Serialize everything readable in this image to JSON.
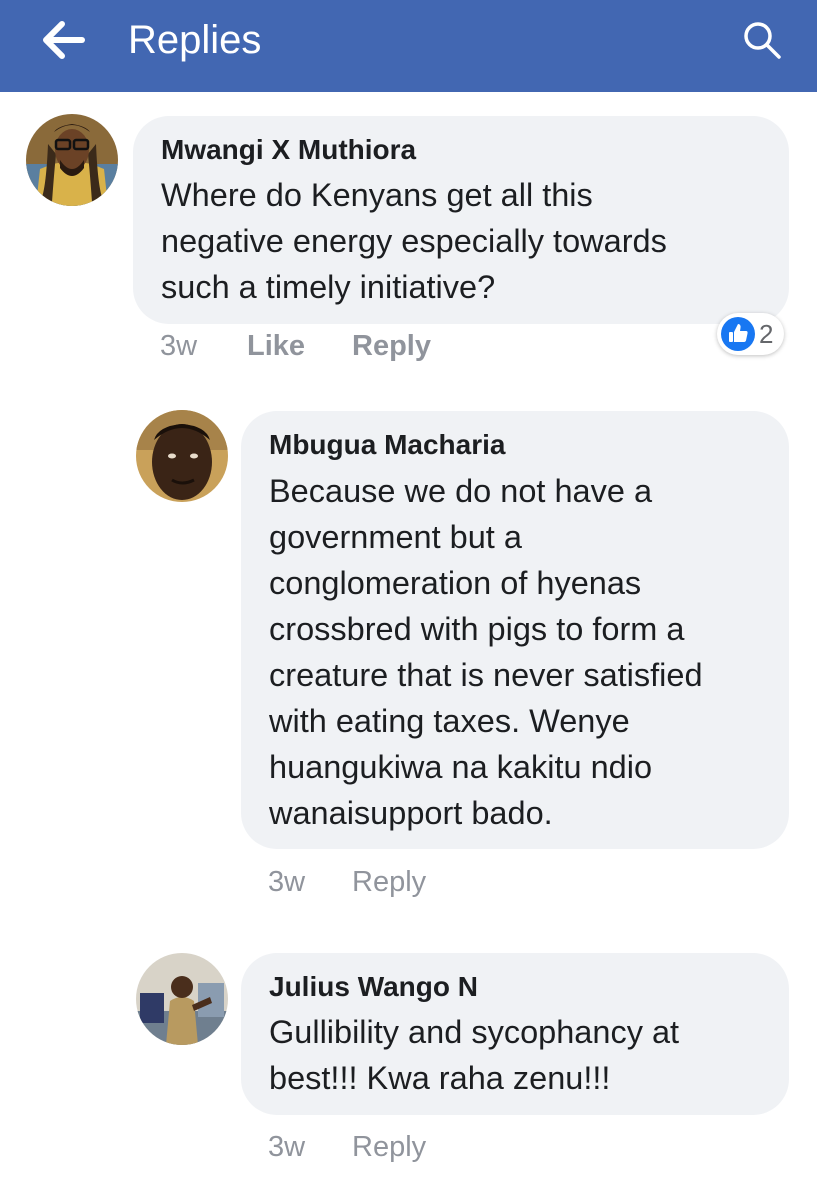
{
  "header": {
    "title": "Replies",
    "background": "#4267b2",
    "back_icon": "arrow-left-icon",
    "search_icon": "search-icon"
  },
  "comments": [
    {
      "author": "Mwangi X Muthiora",
      "text": "Where do Kenyans get all this\nnegative energy especially towards\nsuch a timely initiative?",
      "time": "3w",
      "like_label": "Like",
      "reply_label": "Reply",
      "reaction_count": "2",
      "reaction_icon": "thumbs-up-icon"
    },
    {
      "author": "Mbugua Macharia",
      "text": "Because we do not have a\ngovernment but a\nconglomeration of hyenas\ncrossbred with pigs to form a\ncreature that is never satisfied\nwith eating taxes. Wenye\nhuangukiwa na kakitu ndio\nwanaisupport bado.",
      "time": "3w",
      "reply_label": "Reply"
    },
    {
      "author": "Julius Wango N",
      "text": "Gullibility and sycophancy at\nbest!!! Kwa raha zenu!!!",
      "time": "3w",
      "reply_label": "Reply"
    }
  ],
  "colors": {
    "bubble": "#f0f2f5",
    "meta_text": "#90949c",
    "like_blue": "#1877f2"
  }
}
